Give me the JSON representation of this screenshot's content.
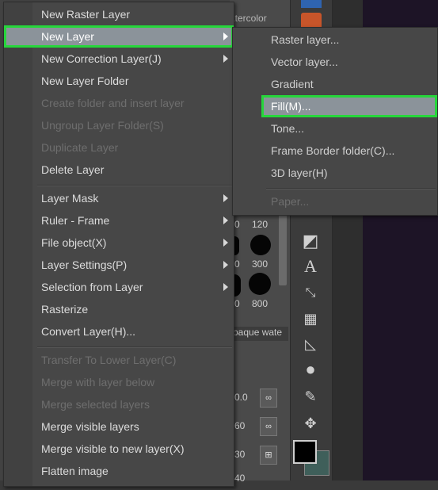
{
  "background": {
    "brush_panel": {
      "tab_label": "atercolor",
      "tab2_label": "paque wate",
      "brush_sizes": [
        "120",
        "300",
        "800"
      ],
      "partial_numbers": [
        "0",
        "0",
        "0"
      ],
      "mini_values": [
        "0.0",
        "60",
        "30",
        "40"
      ]
    },
    "colors": {
      "accent_highlight": "#26d63b",
      "hover_bg": "#8b939a",
      "canvas": "#1d1426"
    }
  },
  "context_menu": {
    "items": [
      {
        "label": "New Raster Layer",
        "disabled": false,
        "submenu": false
      },
      {
        "label": "New Layer",
        "disabled": false,
        "submenu": true,
        "hover": true
      },
      {
        "label": "New Correction Layer(J)",
        "disabled": false,
        "submenu": true
      },
      {
        "label": "New Layer Folder",
        "disabled": false,
        "submenu": false
      },
      {
        "label": "Create folder and insert layer",
        "disabled": true,
        "submenu": false
      },
      {
        "label": "Ungroup Layer Folder(S)",
        "disabled": true,
        "submenu": false
      },
      {
        "label": "Duplicate Layer",
        "disabled": true,
        "submenu": false
      },
      {
        "label": "Delete Layer",
        "disabled": false,
        "submenu": false
      },
      {
        "label": "Layer Mask",
        "disabled": false,
        "submenu": true
      },
      {
        "label": "Ruler - Frame",
        "disabled": false,
        "submenu": true
      },
      {
        "label": "File object(X)",
        "disabled": false,
        "submenu": true
      },
      {
        "label": "Layer Settings(P)",
        "disabled": false,
        "submenu": true
      },
      {
        "label": "Selection from Layer",
        "disabled": false,
        "submenu": true
      },
      {
        "label": "Rasterize",
        "disabled": false,
        "submenu": false
      },
      {
        "label": "Convert Layer(H)...",
        "disabled": false,
        "submenu": false
      },
      {
        "label": "Transfer To Lower Layer(C)",
        "disabled": true,
        "submenu": false
      },
      {
        "label": "Merge with layer below",
        "disabled": true,
        "submenu": false
      },
      {
        "label": "Merge selected layers",
        "disabled": true,
        "submenu": false
      },
      {
        "label": "Merge visible layers",
        "disabled": false,
        "submenu": false
      },
      {
        "label": "Merge visible to new layer(X)",
        "disabled": false,
        "submenu": false
      },
      {
        "label": "Flatten image",
        "disabled": false,
        "submenu": false
      }
    ]
  },
  "submenu": {
    "items": [
      {
        "label": "Raster layer...",
        "disabled": false
      },
      {
        "label": "Vector layer...",
        "disabled": false
      },
      {
        "label": "Gradient",
        "disabled": false
      },
      {
        "label": "Fill(M)...",
        "disabled": false,
        "hover": true
      },
      {
        "label": "Tone...",
        "disabled": false
      },
      {
        "label": "Frame Border folder(C)...",
        "disabled": false
      },
      {
        "label": "3D layer(H)",
        "disabled": false
      },
      {
        "label": "Paper...",
        "disabled": true
      }
    ]
  }
}
